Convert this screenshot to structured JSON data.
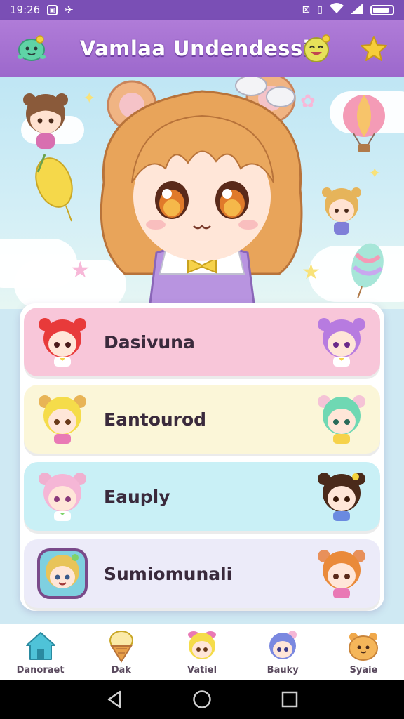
{
  "status_bar": {
    "time": "19:26",
    "icons": [
      "notification-icon",
      "airplane-icon",
      "no-sim-icon",
      "vibrate-icon",
      "wifi-icon",
      "signal-icon",
      "battery-icon"
    ]
  },
  "header": {
    "title": "Vamlaa Undendessia",
    "left_icon": "green-creature-icon",
    "right_icons": [
      "smiley-face-icon",
      "star-icon"
    ]
  },
  "hero": {
    "image": "chibi-girl-with-bear-ears"
  },
  "list": {
    "items": [
      {
        "label": "Dasivuna",
        "color": "#f8c6d9",
        "left_avatar": "red-hair-chibi",
        "right_avatar": "purple-hair-chibi"
      },
      {
        "label": "Eantourod",
        "color": "#fbf6d8",
        "left_avatar": "blonde-chibi",
        "right_avatar": "mint-hair-chibi"
      },
      {
        "label": "Eauply",
        "color": "#c9f0f6",
        "left_avatar": "pink-hair-chibi",
        "right_avatar": "dark-hair-chibi"
      },
      {
        "label": "Sumiomunali",
        "color": "#ecebf9",
        "left_avatar": "framed-blonde-chibi",
        "right_avatar": "orange-hair-chibi"
      }
    ]
  },
  "bottom_nav": {
    "items": [
      {
        "label": "Danoraet",
        "icon": "home-icon"
      },
      {
        "label": "Dak",
        "icon": "ice-cream-icon"
      },
      {
        "label": "Vatiel",
        "icon": "blonde-chibi-icon"
      },
      {
        "label": "Bauky",
        "icon": "blue-hair-chibi-icon"
      },
      {
        "label": "Syaie",
        "icon": "orange-creature-icon"
      }
    ]
  },
  "colors": {
    "header": "#a772d2",
    "row1": "#f8c6d9",
    "row2": "#fbf6d8",
    "row3": "#c9f0f6",
    "row4": "#ecebf9",
    "home_icon": "#4fc3d8"
  }
}
